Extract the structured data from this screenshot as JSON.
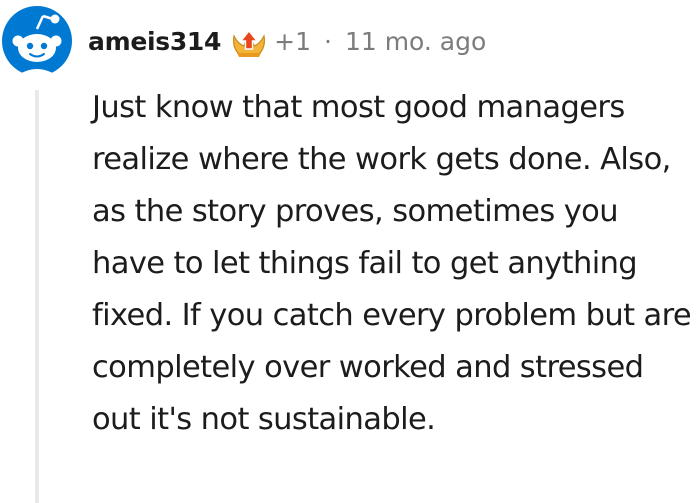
{
  "comment": {
    "username": "ameis314",
    "score": "+1",
    "separator": "·",
    "timestamp": "11 mo. ago",
    "body": "Just know that most good managers realize where the work gets done. Also, as the story proves, sometimes you have to let things fail to get anything fixed. If you catch every problem but are completely over worked and stressed out it's not sustainable.",
    "avatar_icon": "snoo-avatar-icon",
    "flair_icon": "upvote-crown-badge-icon"
  },
  "colors": {
    "text": "#1c1c1c",
    "meta": "#7c7c7c",
    "avatar_blue": "#0079d3",
    "thread_line": "#e9e9e9",
    "flair_gold": "#f2b53a",
    "flair_red": "#e8461d"
  }
}
